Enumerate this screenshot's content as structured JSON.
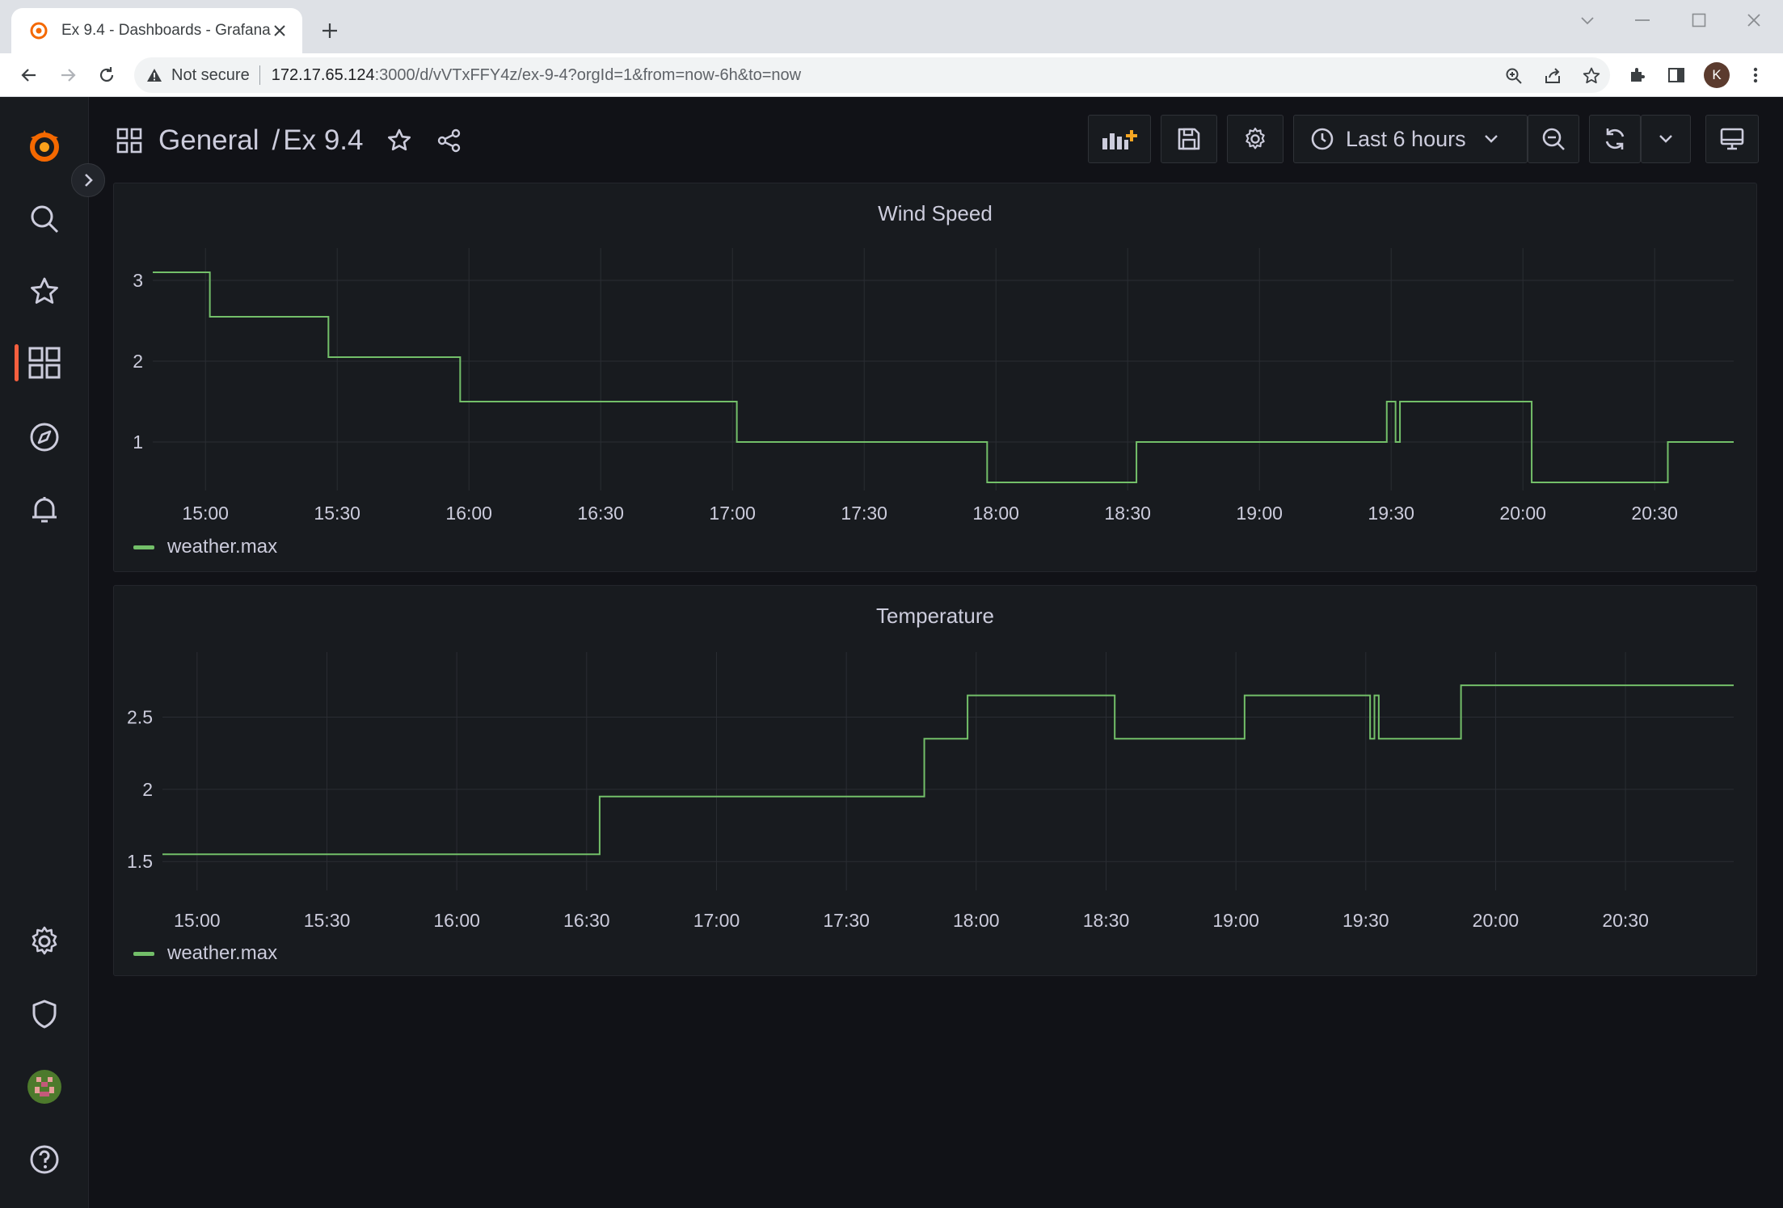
{
  "browser": {
    "tab_title": "Ex 9.4 - Dashboards - Grafana",
    "security_label": "Not secure",
    "url_host": "172.17.65.124",
    "url_path": ":3000/d/vVTxFFY4z/ex-9-4?orgId=1&from=now-6h&to=now",
    "profile_initial": "K"
  },
  "dashboard": {
    "folder": "General",
    "separator": "/",
    "title": "Ex 9.4",
    "time_range_label": "Last 6 hours"
  },
  "colors": {
    "series": "#73bf69",
    "accent": "#f55f3e",
    "background": "#111217",
    "panel": "#181b1f"
  },
  "panels": [
    {
      "title": "Wind Speed",
      "legend": "weather.max"
    },
    {
      "title": "Temperature",
      "legend": "weather.max"
    }
  ],
  "chart_data": [
    {
      "type": "line",
      "title": "Wind Speed",
      "xlabel": "",
      "ylabel": "",
      "x_ticks": [
        "15:00",
        "15:30",
        "16:00",
        "16:30",
        "17:00",
        "17:30",
        "18:00",
        "18:30",
        "19:00",
        "19:30",
        "20:00",
        "20:30"
      ],
      "y_ticks": [
        1,
        2,
        3
      ],
      "xlim": [
        "14:48",
        "20:48"
      ],
      "ylim": [
        0.4,
        3.4
      ],
      "grid": true,
      "legend_position": "bottom-left",
      "step": "after",
      "series": [
        {
          "name": "weather.max",
          "color": "#73bf69",
          "x": [
            "14:48",
            "15:01",
            "15:28",
            "15:58",
            "17:01",
            "17:58",
            "18:32",
            "19:29",
            "19:31",
            "19:32",
            "20:02",
            "20:33",
            "20:48"
          ],
          "y": [
            3.1,
            2.55,
            2.05,
            1.5,
            1.0,
            0.5,
            1.0,
            1.5,
            1.0,
            1.5,
            0.5,
            1.0,
            1.0
          ]
        }
      ]
    },
    {
      "type": "line",
      "title": "Temperature",
      "xlabel": "",
      "ylabel": "",
      "x_ticks": [
        "15:00",
        "15:30",
        "16:00",
        "16:30",
        "17:00",
        "17:30",
        "18:00",
        "18:30",
        "19:00",
        "19:30",
        "20:00",
        "20:30"
      ],
      "y_ticks": [
        1.5,
        2,
        2.5
      ],
      "xlim": [
        "14:52",
        "20:55"
      ],
      "ylim": [
        1.3,
        2.95
      ],
      "grid": true,
      "legend_position": "bottom-left",
      "step": "after",
      "series": [
        {
          "name": "weather.max",
          "color": "#73bf69",
          "x": [
            "14:52",
            "16:33",
            "17:48",
            "17:58",
            "18:32",
            "19:02",
            "19:31",
            "19:32",
            "19:33",
            "19:52",
            "20:55"
          ],
          "y": [
            1.55,
            1.95,
            2.35,
            2.65,
            2.35,
            2.65,
            2.35,
            2.65,
            2.35,
            2.72,
            2.72
          ]
        }
      ]
    }
  ]
}
